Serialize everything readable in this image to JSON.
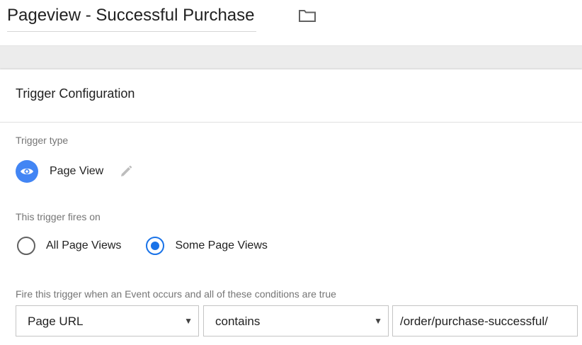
{
  "header": {
    "title": "Pageview - Successful Purchase",
    "folder_icon": "folder-icon"
  },
  "card": {
    "title": "Trigger Configuration",
    "trigger_type": {
      "label": "Trigger type",
      "name": "Page View",
      "icon": "eye-icon",
      "edit_icon": "pencil-icon",
      "icon_color": "#4285f4"
    },
    "fires_on": {
      "label": "This trigger fires on",
      "options": [
        {
          "label": "All Page Views",
          "selected": false
        },
        {
          "label": "Some Page Views",
          "selected": true
        }
      ],
      "accent_color": "#1a73e8"
    },
    "condition": {
      "label": "Fire this trigger when an Event occurs and all of these conditions are true",
      "variable": "Page URL",
      "operator": "contains",
      "value": "/order/purchase-successful/"
    }
  }
}
